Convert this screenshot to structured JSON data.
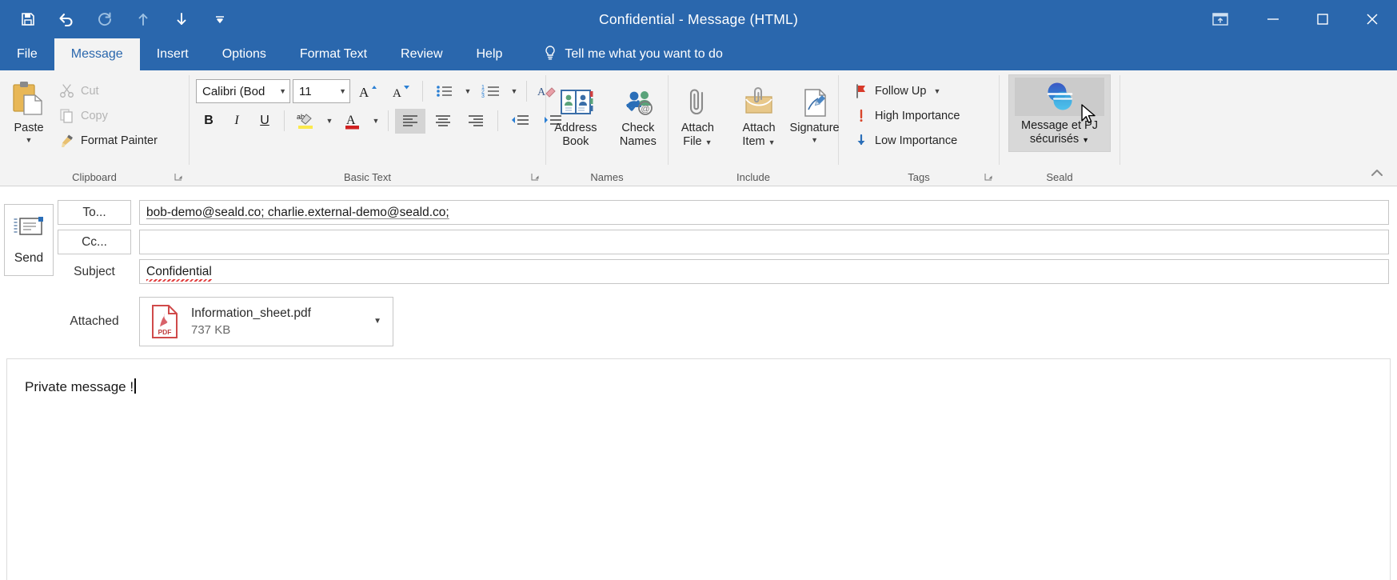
{
  "window": {
    "title": "Confidential  -  Message (HTML)",
    "accent_color": "#2a67ad",
    "quick_access": [
      {
        "name": "save",
        "icon": "save-icon"
      },
      {
        "name": "undo",
        "icon": "undo-icon"
      },
      {
        "name": "redo",
        "icon": "redo-icon"
      },
      {
        "name": "previous-item",
        "icon": "up-arrow-icon"
      },
      {
        "name": "next-item",
        "icon": "down-arrow-icon"
      },
      {
        "name": "customize-qat",
        "icon": "chevron-down-icon"
      }
    ],
    "controls": [
      {
        "name": "ribbon-display-options",
        "icon": "ribbon-options-icon"
      },
      {
        "name": "minimize",
        "icon": "minimize-icon"
      },
      {
        "name": "maximize",
        "icon": "maximize-icon"
      },
      {
        "name": "close",
        "icon": "close-icon"
      }
    ]
  },
  "tabs": [
    {
      "label": "File",
      "active": false
    },
    {
      "label": "Message",
      "active": true
    },
    {
      "label": "Insert",
      "active": false
    },
    {
      "label": "Options",
      "active": false
    },
    {
      "label": "Format Text",
      "active": false
    },
    {
      "label": "Review",
      "active": false
    },
    {
      "label": "Help",
      "active": false
    }
  ],
  "tell_me": {
    "label": "Tell me what you want to do",
    "icon": "lightbulb-icon"
  },
  "ribbon": {
    "clipboard": {
      "group_label": "Clipboard",
      "paste": "Paste",
      "cut": "Cut",
      "copy": "Copy",
      "format_painter": "Format Painter"
    },
    "basic_text": {
      "group_label": "Basic Text",
      "font_name": "Calibri (Bod",
      "font_size": "11",
      "grow_font": "A",
      "shrink_font": "A",
      "bold": "B",
      "italic": "I",
      "underline": "U"
    },
    "names": {
      "group_label": "Names",
      "address_book": "Address Book",
      "check_names": "Check Names"
    },
    "include": {
      "group_label": "Include",
      "attach_file": "Attach File",
      "attach_item": "Attach Item",
      "signature": "Signature"
    },
    "tags": {
      "group_label": "Tags",
      "follow_up": "Follow Up",
      "high_importance": "High Importance",
      "low_importance": "Low Importance"
    },
    "seald": {
      "group_label": "Seald",
      "button_line1": "Message et PJ",
      "button_line2": "sécurisés",
      "icon": "seald-logo-icon",
      "state": "hovered"
    }
  },
  "compose": {
    "send_label": "Send",
    "to_label": "To...",
    "cc_label": "Cc...",
    "subject_label": "Subject",
    "attached_label": "Attached",
    "to_value": "bob-demo@seald.co; charlie.external-demo@seald.co;",
    "cc_value": "",
    "subject_value": "Confidential",
    "attachment": {
      "file_name": "Information_sheet.pdf",
      "file_size": "737 KB",
      "icon": "pdf-file-icon"
    }
  },
  "body": {
    "text": "Private message !"
  }
}
